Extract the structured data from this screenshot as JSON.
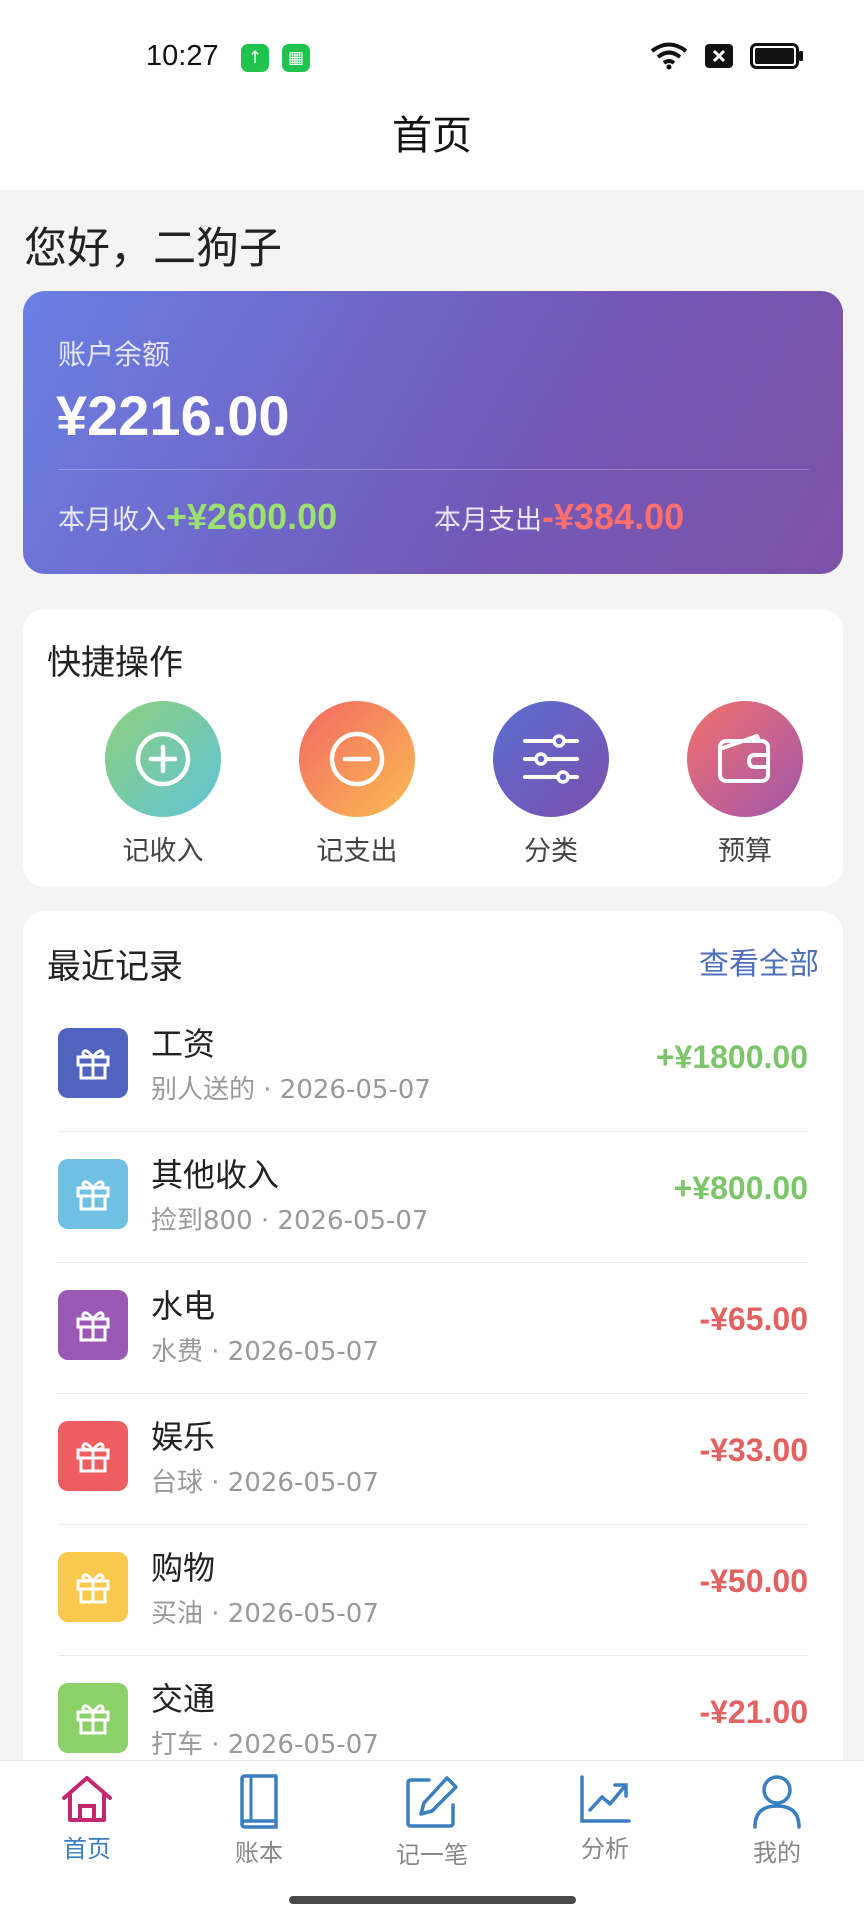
{
  "status_bar": {
    "time": "10:27"
  },
  "nav": {
    "title": "首页"
  },
  "greeting": "您好，二狗子",
  "balance": {
    "label": "账户余额",
    "amount": "¥2216.00",
    "income_label": "本月收入",
    "income_value": "+¥2600.00",
    "expense_label": "本月支出",
    "expense_value": "-¥384.00"
  },
  "quick": {
    "title": "快捷操作",
    "items": [
      {
        "label": "记收入",
        "icon": "plus-circle-icon"
      },
      {
        "label": "记支出",
        "icon": "minus-circle-icon"
      },
      {
        "label": "分类",
        "icon": "sliders-icon"
      },
      {
        "label": "预算",
        "icon": "wallet-icon"
      }
    ]
  },
  "recent": {
    "title": "最近记录",
    "view_all": "查看全部",
    "records": [
      {
        "category": "工资",
        "note": "别人送的 · 2026-05-07",
        "amount": "+¥1800.00",
        "color": "#4f63bf",
        "type": "income"
      },
      {
        "category": "其他收入",
        "note": "捡到800 · 2026-05-07",
        "amount": "+¥800.00",
        "color": "#6fc0e3",
        "type": "income"
      },
      {
        "category": "水电",
        "note": "水费 · 2026-05-07",
        "amount": "-¥65.00",
        "color": "#9b59b6",
        "type": "expense"
      },
      {
        "category": "娱乐",
        "note": "台球 · 2026-05-07",
        "amount": "-¥33.00",
        "color": "#ee5e60",
        "type": "expense"
      },
      {
        "category": "购物",
        "note": "买油 · 2026-05-07",
        "amount": "-¥50.00",
        "color": "#f9c94e",
        "type": "expense"
      },
      {
        "category": "交通",
        "note": "打车 · 2026-05-07",
        "amount": "-¥21.00",
        "color": "#8cd06a",
        "type": "expense"
      }
    ]
  },
  "tabs": [
    {
      "label": "首页",
      "icon": "home-icon",
      "active": true
    },
    {
      "label": "账本",
      "icon": "book-icon"
    },
    {
      "label": "记一笔",
      "icon": "edit-icon"
    },
    {
      "label": "分析",
      "icon": "chart-icon"
    },
    {
      "label": "我的",
      "icon": "user-icon"
    }
  ],
  "colors": {
    "income": "#7cc56a",
    "expense": "#e26262",
    "accent": "#3a7fc0",
    "home_active": "#c2276f"
  }
}
